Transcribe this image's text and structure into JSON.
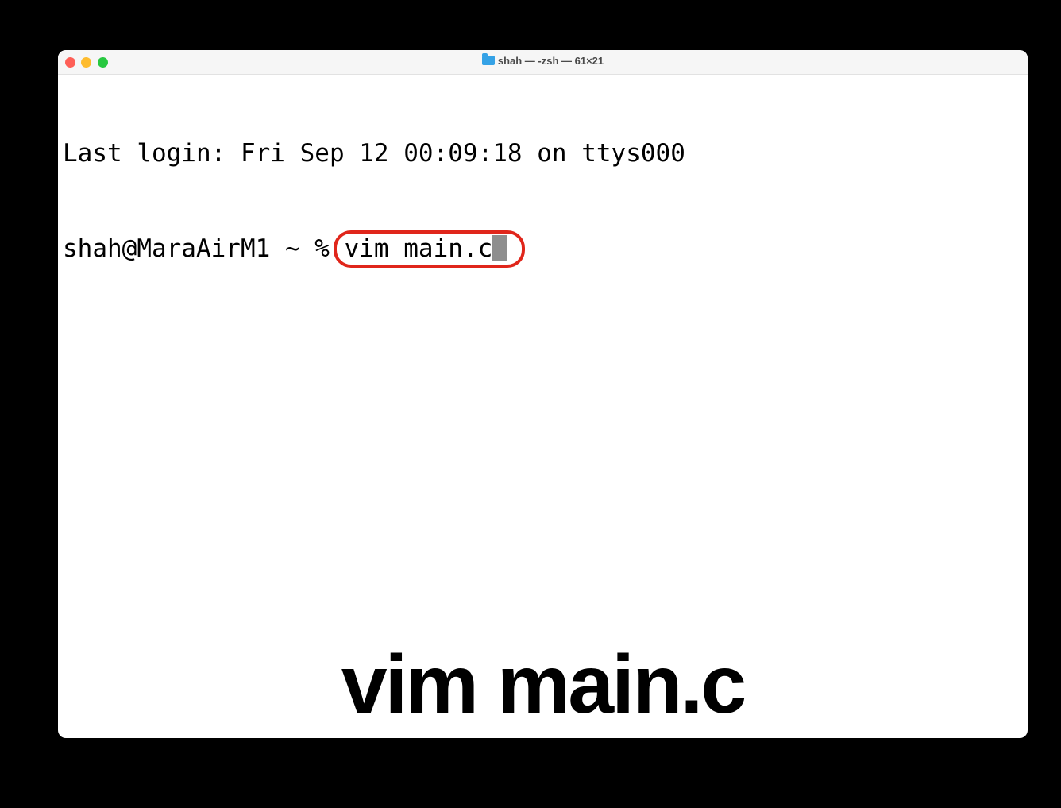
{
  "window": {
    "title": "shah — -zsh — 61×21",
    "title_icon": "folder-icon",
    "traffic_lights": {
      "close_color": "#fe5f57",
      "minimize_color": "#febc2e",
      "maximize_color": "#28c840"
    }
  },
  "terminal": {
    "last_login": "Last login: Fri Sep 12 00:09:18 on ttys000",
    "prompt": "shah@MaraAirM1 ~ % ",
    "command": "vim main.c",
    "highlight_color": "#e0261b"
  },
  "caption": "vim main.c"
}
